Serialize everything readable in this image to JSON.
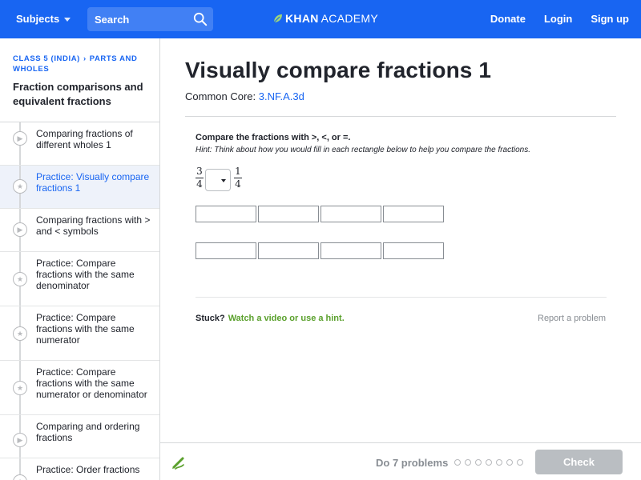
{
  "header": {
    "subjects_label": "Subjects",
    "search_placeholder": "Search",
    "logo_left": "KHAN",
    "logo_right": "ACADEMY",
    "nav": [
      "Donate",
      "Login",
      "Sign up"
    ],
    "brand_color": "#1865f2"
  },
  "sidebar": {
    "breadcrumb": [
      "CLASS 5 (INDIA)",
      "PARTS AND WHOLES"
    ],
    "topic": "Fraction comparisons and equivalent fractions",
    "items": [
      {
        "label": "Comparing fractions of different wholes 1",
        "icon": "play-icon",
        "active": false
      },
      {
        "label": "Practice: Visually compare fractions 1",
        "icon": "star-icon",
        "active": true
      },
      {
        "label": "Comparing fractions with > and < symbols",
        "icon": "play-icon",
        "active": false
      },
      {
        "label": "Practice: Compare fractions with the same denominator",
        "icon": "star-icon",
        "active": false
      },
      {
        "label": "Practice: Compare fractions with the same numerator",
        "icon": "star-icon",
        "active": false
      },
      {
        "label": "Practice: Compare fractions with the same numerator or denominator",
        "icon": "star-icon",
        "active": false
      },
      {
        "label": "Comparing and ordering fractions",
        "icon": "play-icon",
        "active": false
      },
      {
        "label": "Practice: Order fractions",
        "icon": "star-icon",
        "active": false
      }
    ]
  },
  "main": {
    "title": "Visually compare fractions 1",
    "common_core_label": "Common Core:",
    "common_core_code": "3.NF.A.3d",
    "prompt": "Compare the fractions with >, <, or =.",
    "hint": "Hint: Think about how you would fill in each rectangle below to help you compare the fractions.",
    "left_fraction": {
      "num": "3",
      "den": "4"
    },
    "right_fraction": {
      "num": "1",
      "den": "4"
    },
    "comparison_value": "",
    "rectangle_rows": [
      4,
      4
    ],
    "stuck_label": "Stuck?",
    "stuck_link": "Watch a video or use a hint.",
    "report_label": "Report a problem"
  },
  "footer": {
    "problems_label": "Do 7 problems",
    "progress_dots": 7,
    "check_label": "Check"
  }
}
